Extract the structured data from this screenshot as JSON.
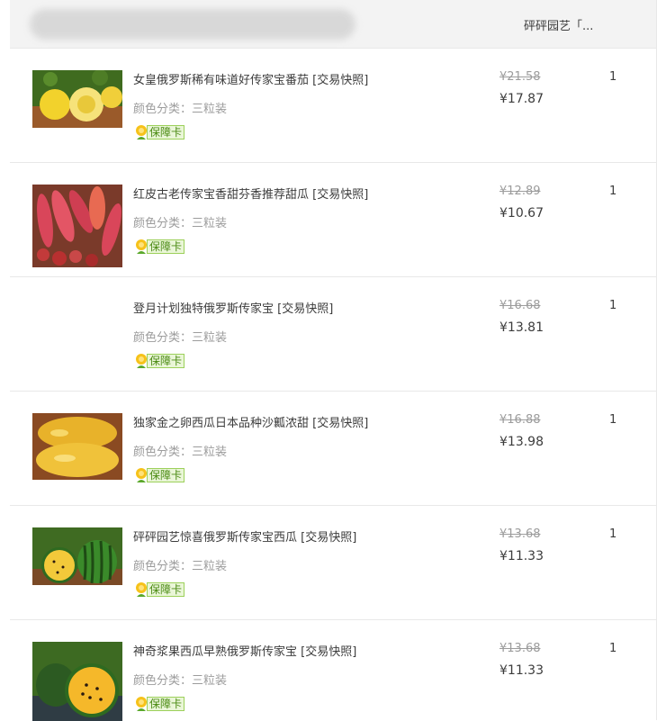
{
  "header": {
    "shop_name": "砰砰园艺「..."
  },
  "items": [
    {
      "title": "女皇俄罗斯稀有味道好传家宝番茄 [交易快照]",
      "variant": "颜色分类：三粒装",
      "badge": "保障卡",
      "original_price": "¥21.58",
      "price": "¥17.87",
      "qty": "1",
      "thumbnail": "yellow-tomato-photo"
    },
    {
      "title": "红皮古老传家宝香甜芬香推荐甜瓜 [交易快照]",
      "variant": "颜色分类：三粒装",
      "badge": "保障卡",
      "original_price": "¥12.89",
      "price": "¥10.67",
      "qty": "1",
      "thumbnail": "red-melon-photo"
    },
    {
      "title": "登月计划独特俄罗斯传家宝 [交易快照]",
      "variant": "颜色分类：三粒装",
      "badge": "保障卡",
      "original_price": "¥16.68",
      "price": "¥13.81",
      "qty": "1",
      "thumbnail": ""
    },
    {
      "title": "独家金之卵西瓜日本品种沙瓤浓甜 [交易快照]",
      "variant": "颜色分类：三粒装",
      "badge": "保障卡",
      "original_price": "¥16.88",
      "price": "¥13.98",
      "qty": "1",
      "thumbnail": "golden-egg-watermelon-photo"
    },
    {
      "title": "砰砰园艺惊喜俄罗斯传家宝西瓜 [交易快照]",
      "variant": "颜色分类：三粒装",
      "badge": "保障卡",
      "original_price": "¥13.68",
      "price": "¥11.33",
      "qty": "1",
      "thumbnail": "watermelon-photo"
    },
    {
      "title": "神奇浆果西瓜早熟俄罗斯传家宝 [交易快照]",
      "variant": "颜色分类：三粒装",
      "badge": "保障卡",
      "original_price": "¥13.68",
      "price": "¥11.33",
      "qty": "1",
      "thumbnail": "yellow-watermelon-photo"
    }
  ],
  "colors": {
    "badge_green": "#4a8a12",
    "strikethrough_gray": "#9c9c9c",
    "header_bg": "#f3f3f3"
  }
}
